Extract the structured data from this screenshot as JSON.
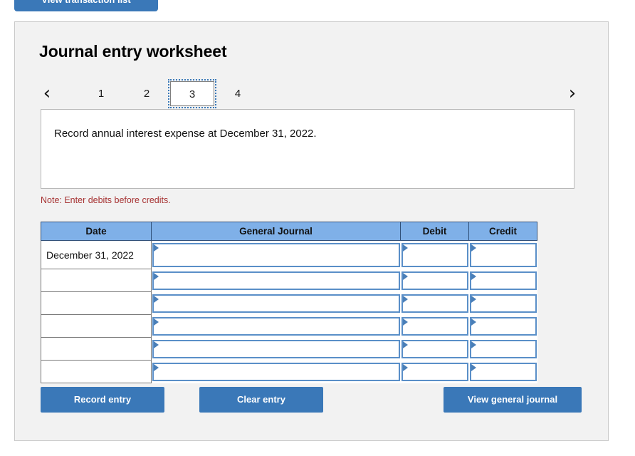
{
  "top_button": {
    "label": "View transaction list",
    "name": "view-transaction-list-button"
  },
  "worksheet": {
    "title": "Journal entry worksheet",
    "pager": {
      "prev_icon": "‹",
      "next_icon": "›",
      "pages": [
        {
          "label": "1",
          "active": false
        },
        {
          "label": "2",
          "active": false
        },
        {
          "label": "3",
          "active": true
        },
        {
          "label": "4",
          "active": false
        }
      ]
    },
    "prompt": "Record annual interest expense at December 31, 2022.",
    "note": "Note: Enter debits before credits."
  },
  "table": {
    "headers": [
      "Date",
      "General Journal",
      "Debit",
      "Credit"
    ],
    "rows": [
      {
        "date": "December 31, 2022",
        "general_journal": "",
        "debit": "",
        "credit": ""
      },
      {
        "date": "",
        "general_journal": "",
        "debit": "",
        "credit": ""
      },
      {
        "date": "",
        "general_journal": "",
        "debit": "",
        "credit": ""
      },
      {
        "date": "",
        "general_journal": "",
        "debit": "",
        "credit": ""
      },
      {
        "date": "",
        "general_journal": "",
        "debit": "",
        "credit": ""
      },
      {
        "date": "",
        "general_journal": "",
        "debit": "",
        "credit": ""
      }
    ]
  },
  "actions": {
    "record_entry": "Record entry",
    "clear_entry": "Clear entry",
    "view_general_journal": "View general journal"
  },
  "colors": {
    "brand_blue": "#3a78b8",
    "header_blue": "#7fb0e8",
    "note_red": "#a63232",
    "card_bg": "#f2f2f2",
    "input_border_blue": "#5a8fc8"
  }
}
